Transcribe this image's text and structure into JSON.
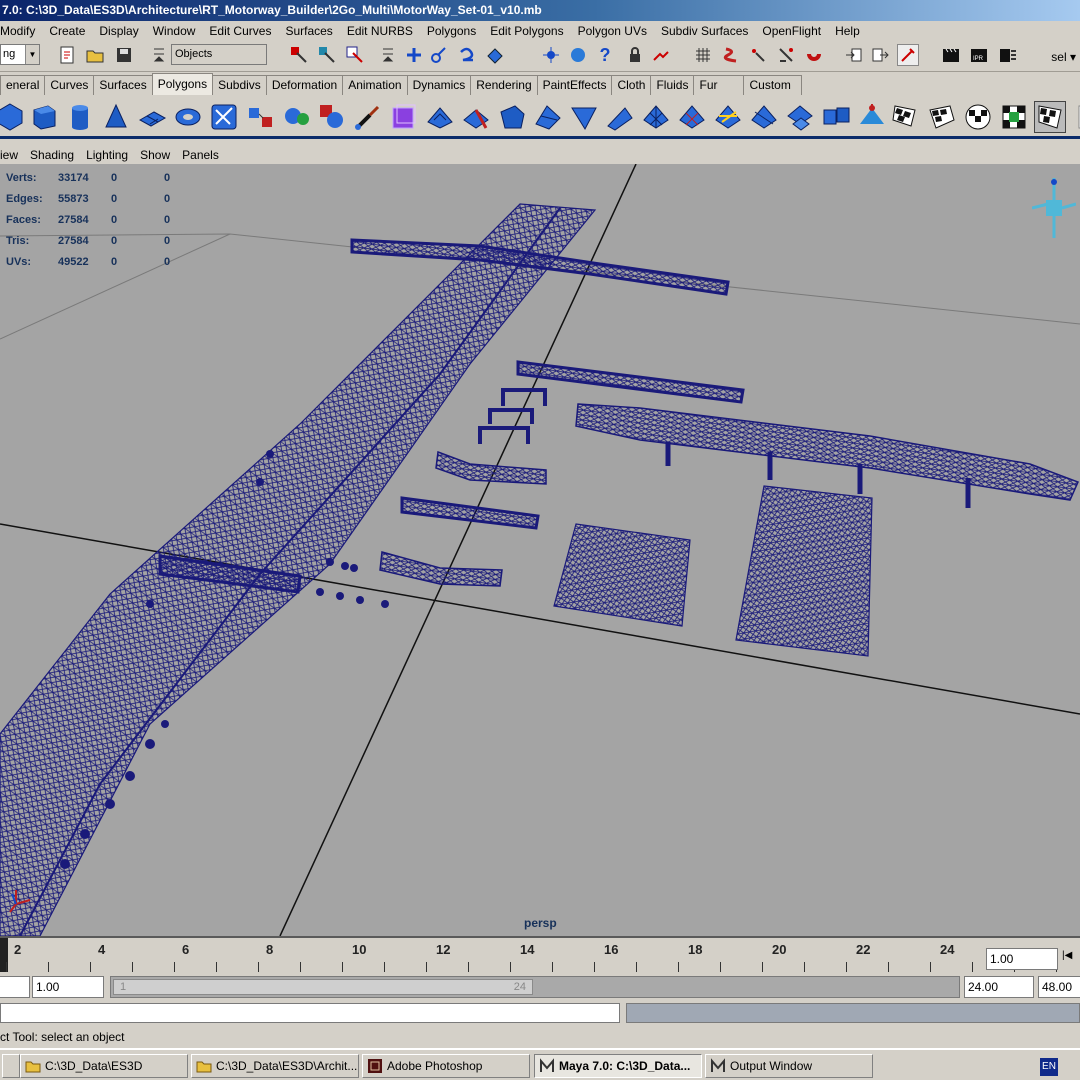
{
  "window": {
    "title": "7.0: C:\\3D_Data\\ES3D\\Architecture\\RT_Motorway_Builder\\2Go_Multi\\MotorWay_Set-01_v10.mb"
  },
  "menubar": {
    "items": [
      "Modify",
      "Create",
      "Display",
      "Window",
      "Edit Curves",
      "Surfaces",
      "Edit NURBS",
      "Polygons",
      "Edit Polygons",
      "Polygon UVs",
      "Subdiv Surfaces",
      "OpenFlight",
      "Help"
    ]
  },
  "statusline": {
    "mode_value": "ng",
    "selection_mask": "Objects",
    "sel_label": "sel"
  },
  "shelf_tabs": {
    "items": [
      "eneral",
      "Curves",
      "Surfaces",
      "Polygons",
      "Subdivs",
      "Deformation",
      "Animation",
      "Dynamics",
      "Rendering",
      "PaintEffects",
      "Cloth",
      "Fluids",
      "Fur",
      "Custom"
    ],
    "active": "Polygons"
  },
  "panel_menu": {
    "items": [
      "iew",
      "Shading",
      "Lighting",
      "Show",
      "Panels"
    ]
  },
  "hud": {
    "rows": [
      {
        "label": "Verts:",
        "values": [
          "33174",
          "0",
          "0"
        ]
      },
      {
        "label": "Edges:",
        "values": [
          "55873",
          "0",
          "0"
        ]
      },
      {
        "label": "Faces:",
        "values": [
          "27584",
          "0",
          "0"
        ]
      },
      {
        "label": "Tris:",
        "values": [
          "27584",
          "0",
          "0"
        ]
      },
      {
        "label": "UVs:",
        "values": [
          "49522",
          "0",
          "0"
        ]
      }
    ]
  },
  "viewport": {
    "camera": "persp",
    "background": "#a4a4a4",
    "wire_color": "#1a1a7a"
  },
  "timeline": {
    "ticks": [
      "2",
      "4",
      "6",
      "8",
      "10",
      "12",
      "14",
      "16",
      "18",
      "20",
      "22",
      "24"
    ],
    "current_frame": "1.00"
  },
  "range": {
    "start": "1.00",
    "slider_start": "1",
    "slider_end": "24",
    "end": "24.00",
    "anim_end": "48.00"
  },
  "helpline": {
    "text": "ct Tool: select an object"
  },
  "taskbar": {
    "items": [
      {
        "label": "C:\\3D_Data\\ES3D",
        "icon": "folder-icon"
      },
      {
        "label": "C:\\3D_Data\\ES3D\\Archit...",
        "icon": "folder-icon"
      },
      {
        "label": "Adobe Photoshop",
        "icon": "photoshop-icon"
      },
      {
        "label": "Maya 7.0: C:\\3D_Data...",
        "icon": "maya-icon"
      },
      {
        "label": "Output Window",
        "icon": "maya-icon"
      }
    ],
    "lang": "EN"
  }
}
